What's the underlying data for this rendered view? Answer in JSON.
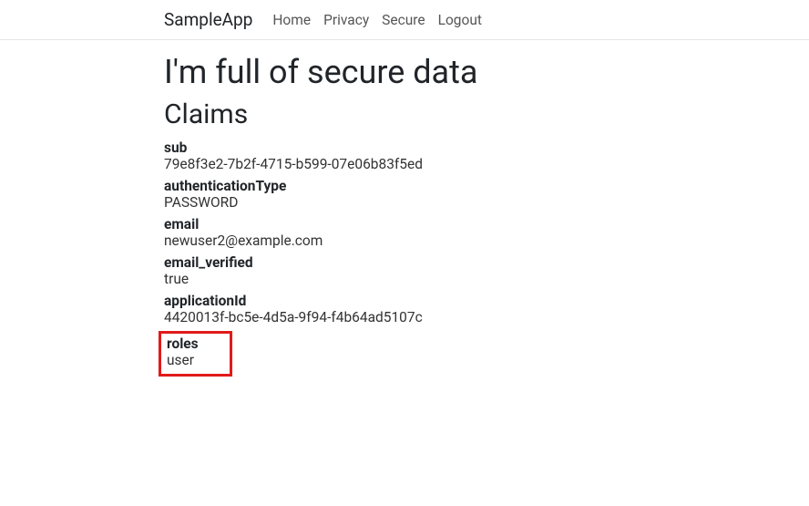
{
  "navbar": {
    "brand": "SampleApp",
    "links": [
      {
        "label": "Home"
      },
      {
        "label": "Privacy"
      },
      {
        "label": "Secure"
      },
      {
        "label": "Logout"
      }
    ]
  },
  "page": {
    "title": "I'm full of secure data",
    "subtitle": "Claims"
  },
  "claims": [
    {
      "key": "sub",
      "value": "79e8f3e2-7b2f-4715-b599-07e06b83f5ed"
    },
    {
      "key": "authenticationType",
      "value": "PASSWORD"
    },
    {
      "key": "email",
      "value": "newuser2@example.com"
    },
    {
      "key": "email_verified",
      "value": "true"
    },
    {
      "key": "applicationId",
      "value": "4420013f-bc5e-4d5a-9f94-f4b64ad5107c"
    },
    {
      "key": "roles",
      "value": "user"
    }
  ]
}
